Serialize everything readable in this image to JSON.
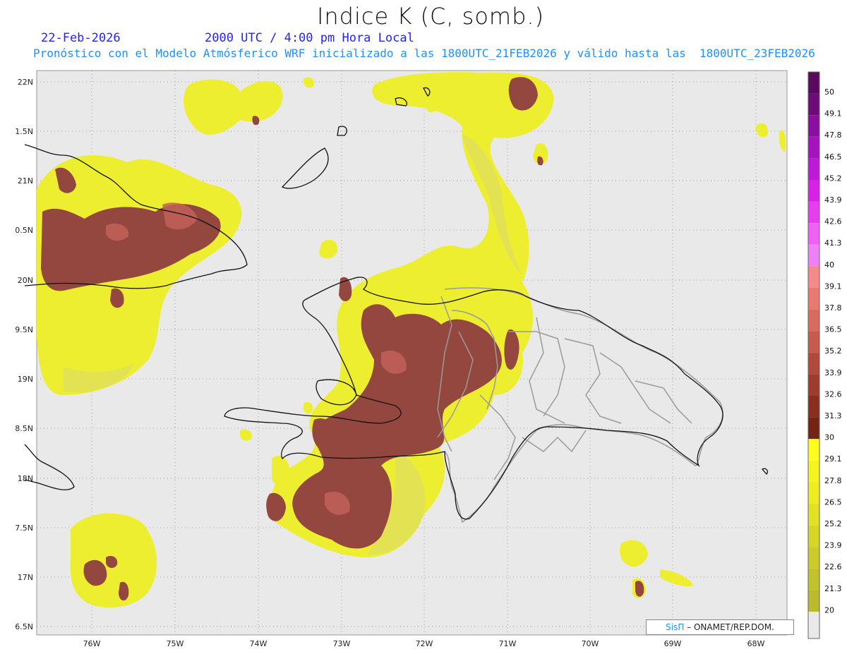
{
  "map": {
    "title": "Indice K (C, somb.)",
    "date": "22-Feb-2026",
    "time": "2000 UTC / 4:00 pm Hora Local",
    "subtitle": "Pronóstico con el Modelo Atmósferico WRF inicializado a las 1800UTC_21FEB2026 y válido hasta las  1800UTC_23FEB2026",
    "lat_labels": [
      "22N",
      "1.5N",
      "21N",
      "0.5N",
      "20N",
      "9.5N",
      "19N",
      "8.5N",
      "18N",
      "7.5N",
      "17N",
      "6.5N"
    ],
    "lon_labels": [
      "76W",
      "75W",
      "74W",
      "73W",
      "72W",
      "71W",
      "70W",
      "69W",
      "68W"
    ],
    "credit_brand": "SisΠ",
    "credit_text": "– ONAMET/REP.DOM."
  },
  "colorbar": {
    "labels": [
      "50",
      "49.1",
      "47.8",
      "46.5",
      "45.2",
      "43.9",
      "42.6",
      "41.3",
      "40",
      "39.1",
      "37.8",
      "36.5",
      "35.2",
      "33.9",
      "32.6",
      "31.3",
      "30",
      "29.1",
      "27.8",
      "26.5",
      "25.2",
      "23.9",
      "22.6",
      "21.3",
      "20"
    ],
    "colors": [
      "#5a0a5e",
      "#6e0b78",
      "#8a0ea0",
      "#a512c0",
      "#c018d8",
      "#d820e8",
      "#e83cf0",
      "#f060f4",
      "#f080f8",
      "#f58a8a",
      "#e87a72",
      "#d86a5e",
      "#c65a4c",
      "#b24a3c",
      "#9e3c2e",
      "#8a2e20",
      "#742414",
      "#fdfd1e",
      "#f4f41e",
      "#eded22",
      "#e2e224",
      "#d6d626",
      "#cccc28",
      "#c2c22a",
      "#babb2c"
    ]
  },
  "colors": {
    "background": "#e9e9e9",
    "yellow": "#eeee30",
    "yellow_light": "#e3e35a",
    "brown": "#93473f",
    "brown_dark": "#7a3026",
    "brown_pink": "#c0605a",
    "coast": "#111111",
    "border": "#9a9a9a"
  }
}
